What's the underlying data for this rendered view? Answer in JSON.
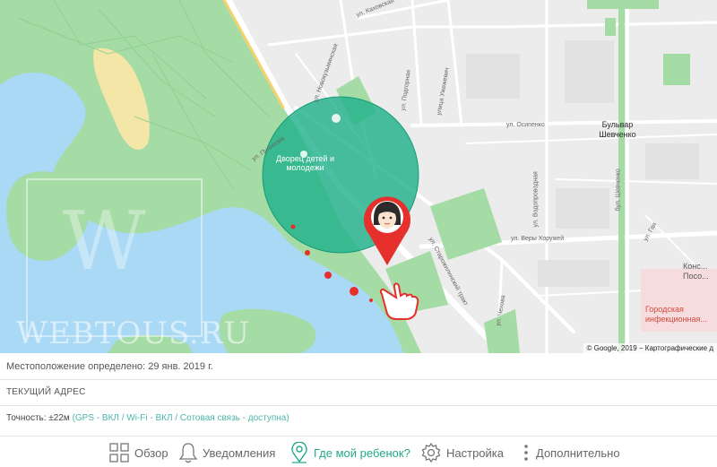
{
  "map": {
    "streets": {
      "kakhovskaya": "ул. Каховская",
      "novokuzminskaya": "ул. Новокузьминская",
      "podgornaya": "ул. Подгорная",
      "ukrainskaya": "улица Ужежевич",
      "osipenko": "ул. Осипенко",
      "vodoprovodnaya": "ул. Водопроводная",
      "shevchenko": "бул. Шевченко",
      "starozhilnaya": "ул. Старожилинский тракт",
      "chervonaya": "ул. Веры Хоружей",
      "chekhova": "ул. Чехова",
      "gaya": "ул. Гая",
      "street_small": "ул. Пулихова"
    },
    "poi_palace": "Дворец детей и молодежи",
    "district": "Бульвар Шевченко",
    "hospital": "Городская инфекционная...",
    "hospital_top": "Конс... Посо...",
    "copyright": "© Google, 2019 − Картографические д",
    "watermark": "WEBTOUS.RU"
  },
  "info": {
    "location_label": "Местоположение определено:",
    "location_date": "29 янв. 2019 г.",
    "address_heading": "ТЕКУЩИЙ АДРЕС",
    "accuracy_label": "Точность: ±22м",
    "accuracy_status": "(GPS - ВКЛ / Wi-Fi - ВКЛ / Сотовая связь - доступна)"
  },
  "nav": {
    "overview": {
      "label": "Обзор",
      "icon": "grid-icon"
    },
    "notifications": {
      "label": "Уведомления",
      "icon": "bell-icon"
    },
    "where_child": {
      "label": "Где мой ребенок?",
      "icon": "location-pin-icon",
      "active": true
    },
    "settings": {
      "label": "Настройка",
      "icon": "gear-icon"
    },
    "more": {
      "label": "Дополнительно",
      "icon": "more-vertical-icon"
    }
  },
  "colors": {
    "accent": "#21a98a",
    "circle_fill": "#1db08a",
    "marker_red": "#e5302c",
    "water": "#a9d9f5",
    "park": "#a5dba5"
  }
}
